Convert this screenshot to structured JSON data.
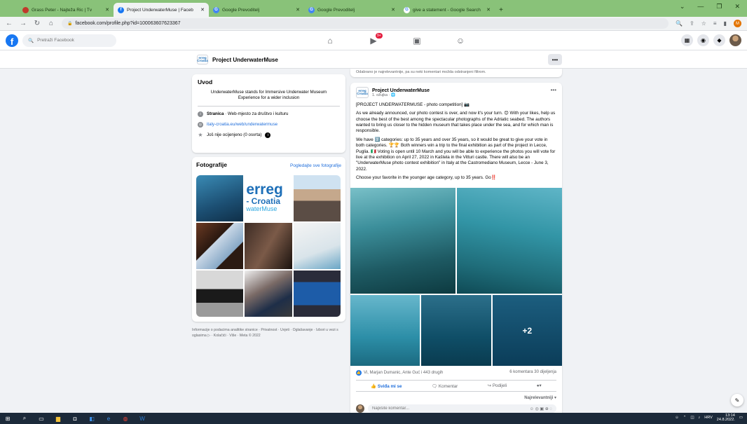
{
  "browser": {
    "tabs": [
      {
        "title": "Grass Peter - Najteža Ric | Tv",
        "active": false
      },
      {
        "title": "Project UnderwaterMuse | Faceb",
        "active": true
      },
      {
        "title": "Google Prevoditelj",
        "active": false
      },
      {
        "title": "Google Prevoditelj",
        "active": false
      },
      {
        "title": "give a statement - Google Search",
        "active": false
      }
    ],
    "url": "facebook.com/profile.php?id=100063607623367",
    "profile_initial": "M"
  },
  "fb": {
    "search_placeholder": "Pretraži Facebook",
    "video_badge": "9+"
  },
  "page": {
    "name": "Project UnderwaterMuse",
    "logo_text": "erreg",
    "logo_sub": "Croatia"
  },
  "intro": {
    "title": "Uvod",
    "bio": "UnderwaterMuse stands for Immersive Underwater Museum Experience for a wider inclusion",
    "category_label": "Stranica",
    "category_value": " · Web-mjesto za društvo i kulturu",
    "website": "italy-croatia.eu/web/underwatermuse",
    "rating": "Još nije ocijenjeno (0 osvrta)"
  },
  "photos": {
    "title": "Fotografije",
    "see_all": "Pogledajte sve fotografije",
    "logo_line1": "erreg",
    "logo_line2": "- Croatia",
    "logo_line3": "waterMuse"
  },
  "footer": "Informacije o podacima analitike stranice · Privatnost · Uvjeti · Oglašavanje · Izbori u vezi s oglasima ▷ · Kolačići · Više · Meta © 2022",
  "top_strip": "Odabrano je najrelevantnije, pa su neki komentari možda odstranjeni filtrom.",
  "post": {
    "author": "Project UnderwaterMuse",
    "time": "1. ožujka · 🌐",
    "p1": "[PROJECT UNDERWATERMUSE - photo competition] 📷",
    "p2": "As we already announced, our photo contest is over, and now it's your turn. 😊 With your likes, help us choose the best of the best among the spectacular photographs of the Adriatic seabed. The authors wanted to bring us closer to the hidden museum that takes place under the sea, and for which man is responsible.",
    "p3": "We have 2️⃣ categories: up to 35 years and over 35 years, so it would be great to give your vote in both categories. 🏆🏆 Both winners win a trip to the final exhibition as part of the project in Lecce, Puglia. 🇮🇹 Voting is open until 10 March and you will be able to experience the photos you will vote for live at the exhibition on April 27, 2022 in Kaštela in the Vitturi castle. There will also be an \"UnderwaterMuse photo contest exhibition\" in Italy at the Castromediano Museum, Lecce - June 3, 2022.",
    "p4": "Choose your favorite in the younger age category, up to 35 years. Go‼️",
    "more_photos": "+2",
    "reactions": "Vi, Marjan Dumanic, Ante Guć i 443 drugih",
    "counts": "6 komentara  30 dijeljenja",
    "like_label": "Sviđa mi se",
    "comment_label": "Komentar",
    "share_label": "Podijeli",
    "sort_label": "Najrelevantniji ▾",
    "comment_placeholder": "Napišite komentar..."
  },
  "taskbar": {
    "lang": "HRV",
    "time": "13:14",
    "date": "24.8.2022."
  }
}
